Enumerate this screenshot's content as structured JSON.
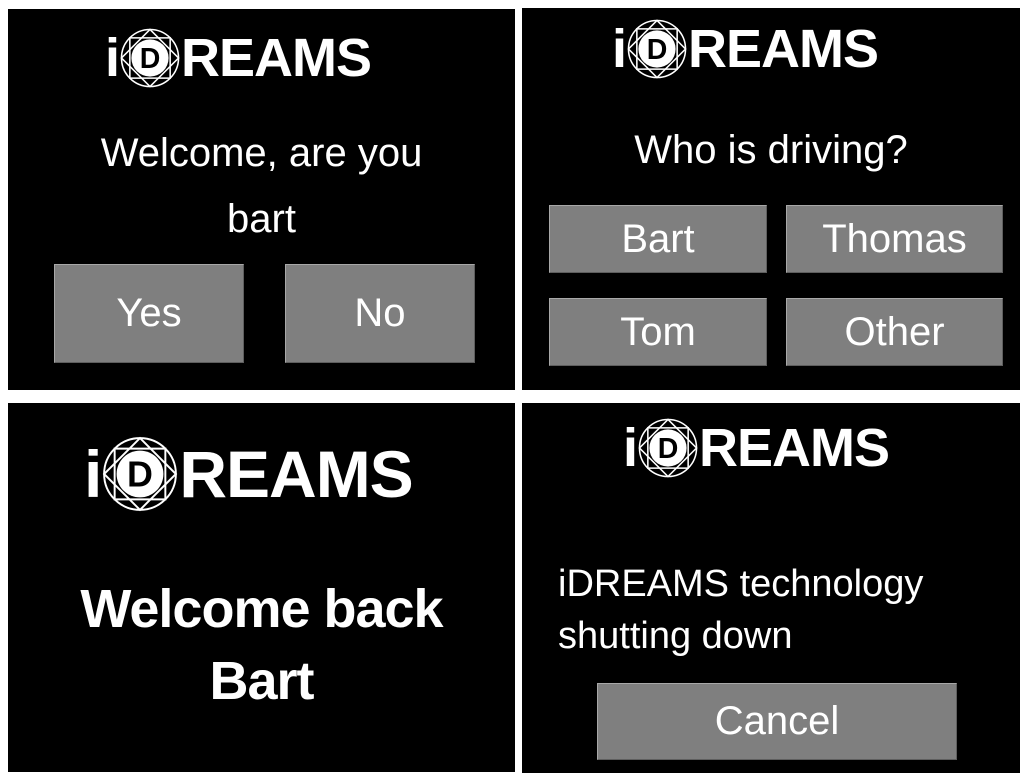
{
  "logo": {
    "prefix": "i",
    "badge_letter": "D",
    "suffix": "REAMS"
  },
  "screens": {
    "confirm_driver": {
      "line1": "Welcome, are you",
      "line2": "bart",
      "yes_label": "Yes",
      "no_label": "No"
    },
    "select_driver": {
      "question": "Who is driving?",
      "options": [
        "Bart",
        "Thomas",
        "Tom",
        "Other"
      ]
    },
    "welcome_back": {
      "line1": "Welcome back",
      "line2": "Bart"
    },
    "shutdown": {
      "line1": "iDREAMS technology",
      "line2": "shutting down",
      "cancel_label": "Cancel"
    }
  },
  "colors": {
    "background": "#000000",
    "text": "#ffffff",
    "button": "#7f7f7f",
    "separator": "#ffffff"
  }
}
